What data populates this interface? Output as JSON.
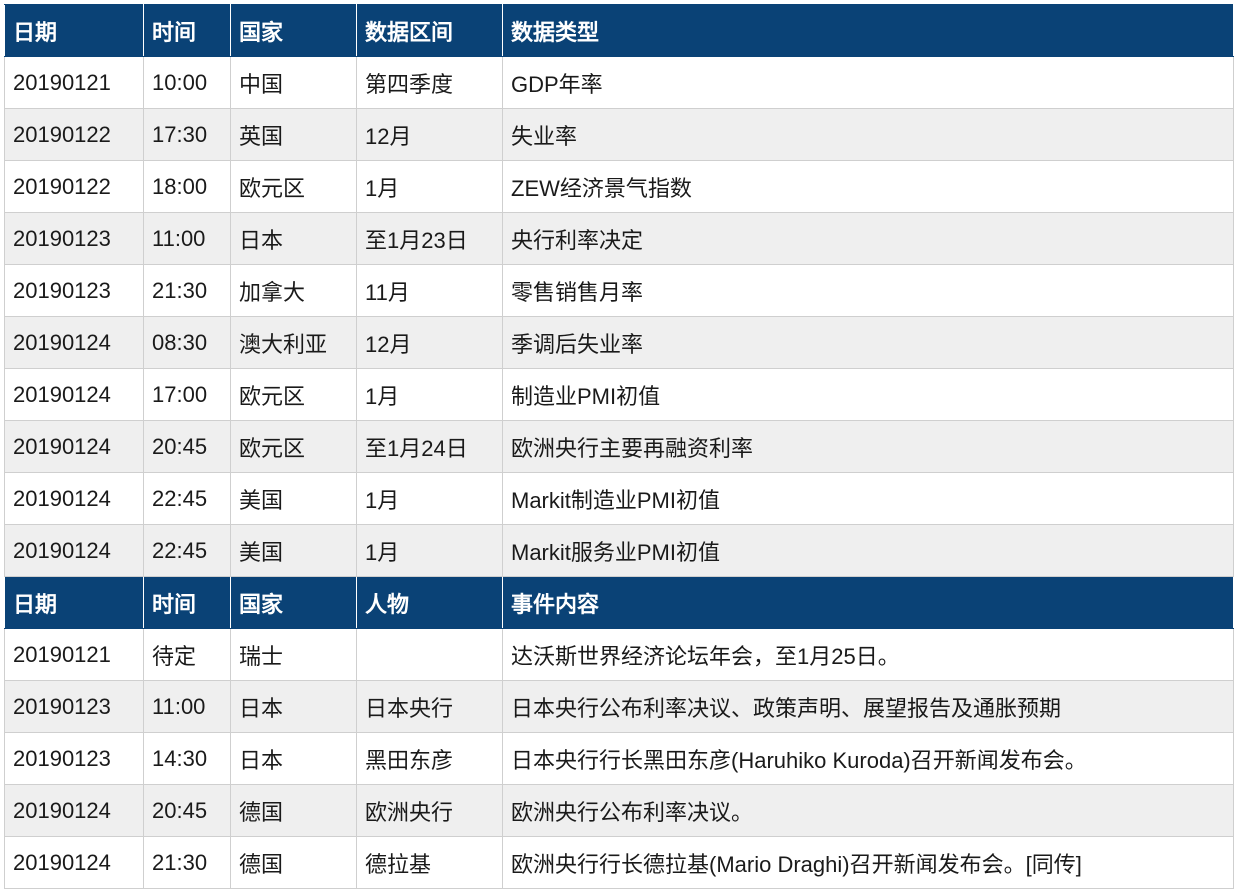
{
  "economic_table": {
    "headers": [
      "日期",
      "时间",
      "国家",
      "数据区间",
      "数据类型"
    ],
    "rows": [
      [
        "20190121",
        "10:00",
        "中国",
        "第四季度",
        "GDP年率"
      ],
      [
        "20190122",
        "17:30",
        "英国",
        "12月",
        "失业率"
      ],
      [
        "20190122",
        "18:00",
        "欧元区",
        "1月",
        "ZEW经济景气指数"
      ],
      [
        "20190123",
        "11:00",
        "日本",
        "至1月23日",
        "央行利率决定"
      ],
      [
        "20190123",
        "21:30",
        "加拿大",
        "11月",
        "零售销售月率"
      ],
      [
        "20190124",
        "08:30",
        "澳大利亚",
        "12月",
        "季调后失业率"
      ],
      [
        "20190124",
        "17:00",
        "欧元区",
        "1月",
        "制造业PMI初值"
      ],
      [
        "20190124",
        "20:45",
        "欧元区",
        "至1月24日",
        "欧洲央行主要再融资利率"
      ],
      [
        "20190124",
        "22:45",
        "美国",
        "1月",
        "Markit制造业PMI初值"
      ],
      [
        "20190124",
        "22:45",
        "美国",
        "1月",
        "Markit服务业PMI初值"
      ]
    ]
  },
  "event_table": {
    "headers": [
      "日期",
      "时间",
      "国家",
      "人物",
      "事件内容"
    ],
    "rows": [
      [
        "20190121",
        "待定",
        "瑞士",
        "",
        "达沃斯世界经济论坛年会，至1月25日。"
      ],
      [
        "20190123",
        "11:00",
        "日本",
        "日本央行",
        "日本央行公布利率决议、政策声明、展望报告及通胀预期"
      ],
      [
        "20190123",
        "14:30",
        "日本",
        "黑田东彦",
        "日本央行行长黑田东彦(Haruhiko Kuroda)召开新闻发布会。"
      ],
      [
        "20190124",
        "20:45",
        "德国",
        "欧洲央行",
        "欧洲央行公布利率决议。"
      ],
      [
        "20190124",
        "21:30",
        "德国",
        "德拉基",
        "欧洲央行行长德拉基(Mario Draghi)召开新闻发布会。[同传]"
      ]
    ]
  },
  "colors": {
    "header_bg": "#0a4276",
    "row_alt_bg": "#efefef"
  }
}
